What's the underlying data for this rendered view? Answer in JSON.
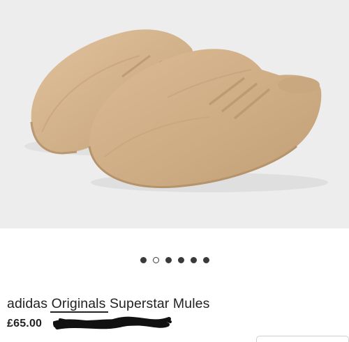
{
  "product": {
    "brand_name": "adidas ",
    "name_highlight": "Originals",
    "name_rest": " Superstar Mules",
    "price": "£65.00"
  },
  "gallery": {
    "image_subject": "mules",
    "slide_count": 6,
    "active_slide": 1
  },
  "colors": {
    "background": "#eeedee",
    "shoe": "#d6b58d",
    "shoe_shadow": "#bf9f78",
    "dot_active": "#3a3a3a"
  }
}
